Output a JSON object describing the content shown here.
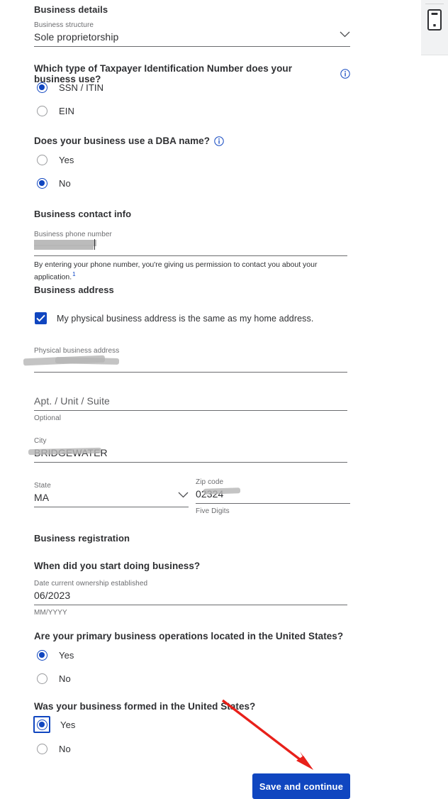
{
  "sections": {
    "business_details": {
      "title": "Business details",
      "business_structure": {
        "label": "Business structure",
        "value": "Sole proprietorship",
        "chevron_icon": "chevron-down-icon"
      },
      "tin_question": {
        "text": "Which type of Taxpayer Identification Number does your business use?",
        "info_icon": "info-icon",
        "options": [
          {
            "label": "SSN / ITIN",
            "selected": true
          },
          {
            "label": "EIN",
            "selected": false
          }
        ]
      },
      "dba_question": {
        "text": "Does your business use a DBA name?",
        "info_icon": "info-icon",
        "options": [
          {
            "label": "Yes",
            "selected": false
          },
          {
            "label": "No",
            "selected": true
          }
        ]
      }
    },
    "business_contact_info": {
      "title": "Business contact info",
      "phone": {
        "label": "Business phone number",
        "value": "",
        "redacted": true,
        "helper": "By entering your phone number, you're giving us permission to contact you about your application.",
        "footnote_marker": "1"
      }
    },
    "business_address": {
      "title": "Business address",
      "same_as_home_checkbox": {
        "label": "My physical business address is the same as my home address.",
        "checked": true,
        "icon": "checkmark-icon"
      },
      "physical_address": {
        "label": "Physical business address",
        "value": "",
        "redacted": true
      },
      "apt": {
        "label": "Apt. / Unit / Suite",
        "value": "",
        "helper": "Optional"
      },
      "city": {
        "label": "City",
        "value": "BRIDGEWATER",
        "redacted": true
      },
      "state": {
        "label": "State",
        "value": "MA",
        "chevron_icon": "chevron-down-icon"
      },
      "zip": {
        "label": "Zip code",
        "value": "02324",
        "redacted": true,
        "helper": "Five Digits"
      }
    },
    "business_registration": {
      "title": "Business registration",
      "start_question": "When did you start doing business?",
      "date_established": {
        "label": "Date current ownership established",
        "value": "06/2023",
        "helper": "MM/YYYY"
      },
      "operations_question": {
        "text": "Are your primary business operations located in the United States?",
        "options": [
          {
            "label": "Yes",
            "selected": true
          },
          {
            "label": "No",
            "selected": false
          }
        ]
      },
      "formed_question": {
        "text": "Was your business formed in the United States?",
        "options": [
          {
            "label": "Yes",
            "selected": true,
            "focused": true
          },
          {
            "label": "No",
            "selected": false
          }
        ]
      }
    }
  },
  "submit_button": {
    "label": "Save and continue"
  },
  "annotation": {
    "arrow_icon": "red-arrow-icon",
    "color": "#e8201a"
  },
  "device_toolbar": {
    "icon": "mobile-device-icon",
    "background": "#f1f2f3"
  },
  "colors": {
    "accent": "#1046c0",
    "text": "#2f3033",
    "muted": "#6b6c6f",
    "annotation": "#e8201a"
  }
}
